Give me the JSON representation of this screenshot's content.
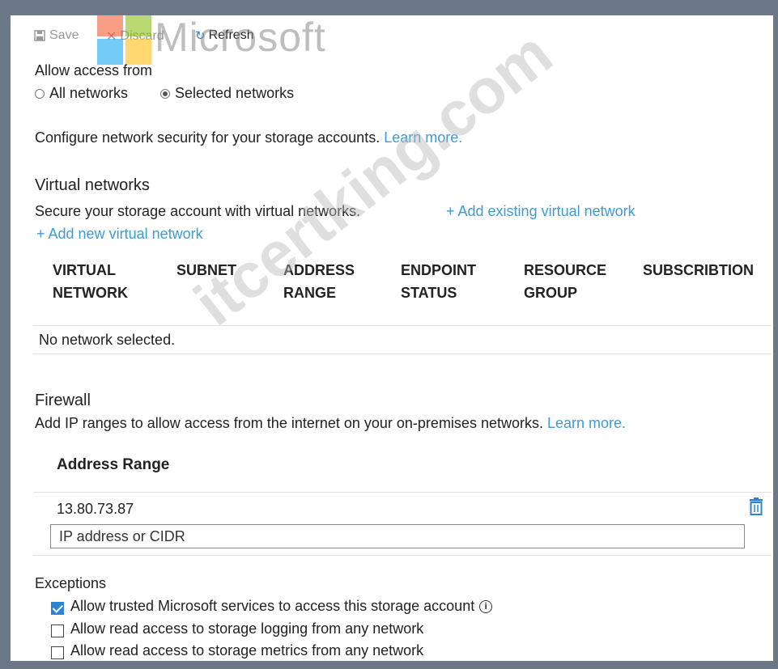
{
  "toolbar": {
    "save_label": "Save",
    "discard_label": "Discard",
    "refresh_label": "Refresh",
    "logo_text": "Microsoft"
  },
  "access": {
    "label": "Allow access from",
    "options": [
      "All networks",
      "Selected networks"
    ],
    "selected": "Selected networks"
  },
  "configure": {
    "text": "Configure network security for your storage accounts.",
    "link": "Learn more."
  },
  "virtual_networks": {
    "heading": "Virtual networks",
    "description": "Secure your storage account with virtual networks.",
    "add_existing": "+ Add existing virtual network",
    "add_new": "+ Add new virtual network",
    "columns": [
      "VIRTUAL NETWORK",
      "SUBNET",
      "ADDRESS RANGE",
      "ENDPOINT STATUS",
      "RESOURCE GROUP",
      "SUBSCRIBTION"
    ],
    "empty": "No network selected."
  },
  "firewall": {
    "heading": "Firewall",
    "description": "Add IP ranges to allow access from the internet on your on-premises networks.",
    "link": "Learn more.",
    "column": "Address Range",
    "rows": [
      "13.80.73.87"
    ],
    "input_placeholder": "IP address or CIDR"
  },
  "exceptions": {
    "heading": "Exceptions",
    "items": [
      {
        "label": "Allow trusted Microsoft services to access this storage account",
        "checked": true
      },
      {
        "label": "Allow read access to storage logging from any network",
        "checked": false
      },
      {
        "label": "Allow read access to storage metrics from any network",
        "checked": false
      }
    ]
  },
  "watermark": "itcertking.com",
  "colors": {
    "link": "#3b9bd6",
    "checkbox": "#2d84d2",
    "delete_icon": "#2d84d2"
  }
}
